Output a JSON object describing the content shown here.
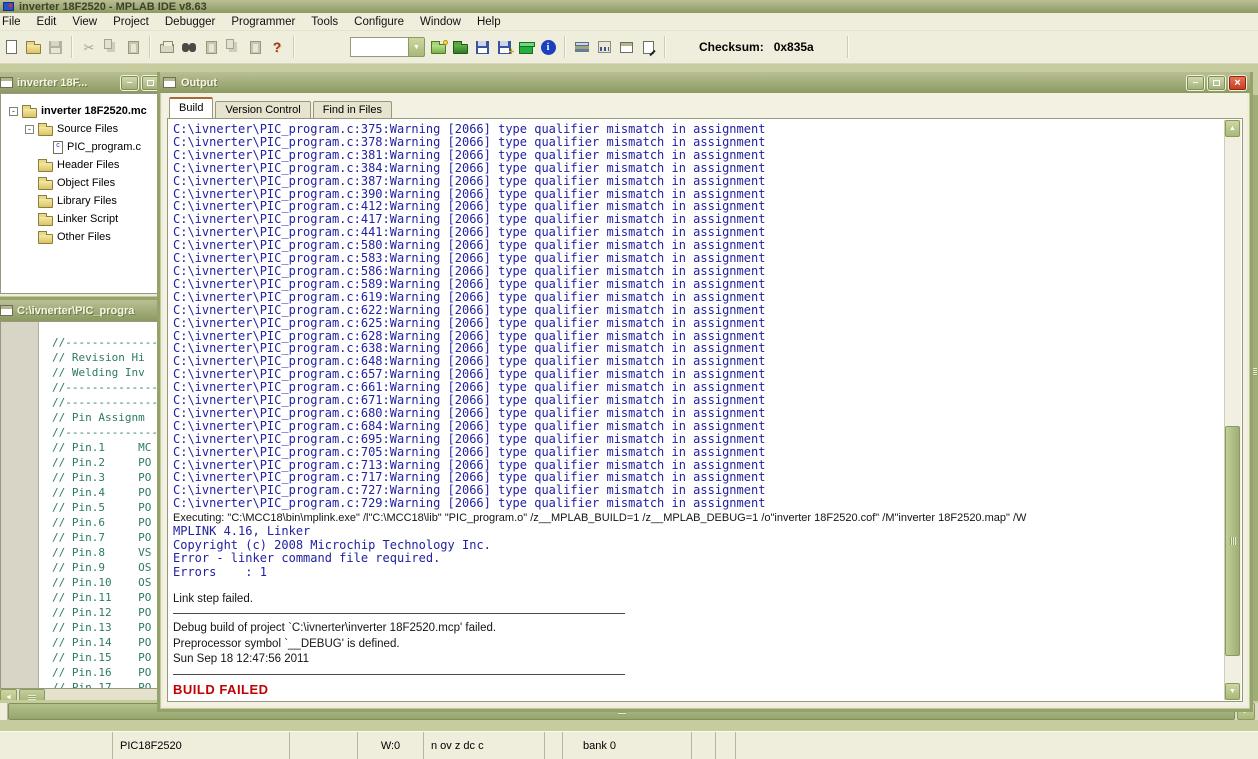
{
  "app": {
    "title": "inverter 18F2520 - MPLAB IDE v8.63"
  },
  "menu": {
    "items": [
      "File",
      "Edit",
      "View",
      "Project",
      "Debugger",
      "Programmer",
      "Tools",
      "Configure",
      "Window",
      "Help"
    ]
  },
  "toolbar": {
    "combo_value": "",
    "checksum_label": "Checksum:",
    "checksum_value": "0x835a"
  },
  "icons": {
    "combo_arrow": "▼",
    "help_glyph": "?",
    "info_glyph": "i",
    "minimize_glyph": "–",
    "close_glyph": "×",
    "scroll_up": "▲",
    "scroll_down": "▼",
    "scroll_left": "◄",
    "scroll_right": "►",
    "expander_collapsed": "-",
    "c_file_glyph": "c"
  },
  "project_window": {
    "title": "inverter 18F...",
    "tree": [
      "inverter 18F2520.mc",
      "Source Files",
      "PIC_program.c",
      "Header Files",
      "Object Files",
      "Library Files",
      "Linker Script",
      "Other Files"
    ]
  },
  "editor_window": {
    "title": "C:\\ivnerter\\PIC_progra",
    "lines": [
      "//---------------------",
      "// Revision Hi",
      "// Welding Inv",
      "//---------------------",
      "",
      "//---------------------",
      "// Pin Assignm",
      "//---------------------",
      "// Pin.1     MC",
      "// Pin.2     PO",
      "// Pin.3     PO",
      "// Pin.4     PO",
      "// Pin.5     PO",
      "// Pin.6     PO",
      "// Pin.7     PO",
      "// Pin.8     VS",
      "// Pin.9     OS",
      "// Pin.10    OS",
      "// Pin.11    PO",
      "// Pin.12    PO",
      "// Pin.13    PO",
      "// Pin.14    PO",
      "// Pin.15    PO",
      "// Pin.16    PO",
      "// Pin.17    PO"
    ]
  },
  "output_window": {
    "title": "Output",
    "tabs": [
      "Build",
      "Version Control",
      "Find in Files"
    ],
    "active_tab": "Build",
    "warnings": [
      "C:\\ivnerter\\PIC_program.c:375:Warning [2066] type qualifier mismatch in assignment",
      "C:\\ivnerter\\PIC_program.c:378:Warning [2066] type qualifier mismatch in assignment",
      "C:\\ivnerter\\PIC_program.c:381:Warning [2066] type qualifier mismatch in assignment",
      "C:\\ivnerter\\PIC_program.c:384:Warning [2066] type qualifier mismatch in assignment",
      "C:\\ivnerter\\PIC_program.c:387:Warning [2066] type qualifier mismatch in assignment",
      "C:\\ivnerter\\PIC_program.c:390:Warning [2066] type qualifier mismatch in assignment",
      "C:\\ivnerter\\PIC_program.c:412:Warning [2066] type qualifier mismatch in assignment",
      "C:\\ivnerter\\PIC_program.c:417:Warning [2066] type qualifier mismatch in assignment",
      "C:\\ivnerter\\PIC_program.c:441:Warning [2066] type qualifier mismatch in assignment",
      "C:\\ivnerter\\PIC_program.c:580:Warning [2066] type qualifier mismatch in assignment",
      "C:\\ivnerter\\PIC_program.c:583:Warning [2066] type qualifier mismatch in assignment",
      "C:\\ivnerter\\PIC_program.c:586:Warning [2066] type qualifier mismatch in assignment",
      "C:\\ivnerter\\PIC_program.c:589:Warning [2066] type qualifier mismatch in assignment",
      "C:\\ivnerter\\PIC_program.c:619:Warning [2066] type qualifier mismatch in assignment",
      "C:\\ivnerter\\PIC_program.c:622:Warning [2066] type qualifier mismatch in assignment",
      "C:\\ivnerter\\PIC_program.c:625:Warning [2066] type qualifier mismatch in assignment",
      "C:\\ivnerter\\PIC_program.c:628:Warning [2066] type qualifier mismatch in assignment",
      "C:\\ivnerter\\PIC_program.c:638:Warning [2066] type qualifier mismatch in assignment",
      "C:\\ivnerter\\PIC_program.c:648:Warning [2066] type qualifier mismatch in assignment",
      "C:\\ivnerter\\PIC_program.c:657:Warning [2066] type qualifier mismatch in assignment",
      "C:\\ivnerter\\PIC_program.c:661:Warning [2066] type qualifier mismatch in assignment",
      "C:\\ivnerter\\PIC_program.c:671:Warning [2066] type qualifier mismatch in assignment",
      "C:\\ivnerter\\PIC_program.c:680:Warning [2066] type qualifier mismatch in assignment",
      "C:\\ivnerter\\PIC_program.c:684:Warning [2066] type qualifier mismatch in assignment",
      "C:\\ivnerter\\PIC_program.c:695:Warning [2066] type qualifier mismatch in assignment",
      "C:\\ivnerter\\PIC_program.c:705:Warning [2066] type qualifier mismatch in assignment",
      "C:\\ivnerter\\PIC_program.c:713:Warning [2066] type qualifier mismatch in assignment",
      "C:\\ivnerter\\PIC_program.c:717:Warning [2066] type qualifier mismatch in assignment",
      "C:\\ivnerter\\PIC_program.c:727:Warning [2066] type qualifier mismatch in assignment",
      "C:\\ivnerter\\PIC_program.c:729:Warning [2066] type qualifier mismatch in assignment"
    ],
    "exec_line": "Executing: \"C:\\MCC18\\bin\\mplink.exe\" /l\"C:\\MCC18\\lib\" \"PIC_program.o\" /z__MPLAB_BUILD=1 /z__MPLAB_DEBUG=1 /o\"inverter 18F2520.cof\" /M\"inverter 18F2520.map\" /W",
    "linker_lines": [
      "MPLINK 4.16, Linker",
      "Copyright (c) 2008 Microchip Technology Inc.",
      "Error - linker command file required.",
      "Errors    : 1"
    ],
    "link_failed": "Link step failed.",
    "messages": [
      "Debug build of project `C:\\ivnerter\\inverter 18F2520.mcp' failed.",
      "Preprocessor symbol `__DEBUG' is defined.",
      "Sun Sep 18 12:47:56 2011"
    ],
    "build_status": "BUILD FAILED"
  },
  "status_bar": {
    "device": "PIC18F2520",
    "w_register": "W:0",
    "flags": "n ov z dc c",
    "bank": "bank 0"
  }
}
